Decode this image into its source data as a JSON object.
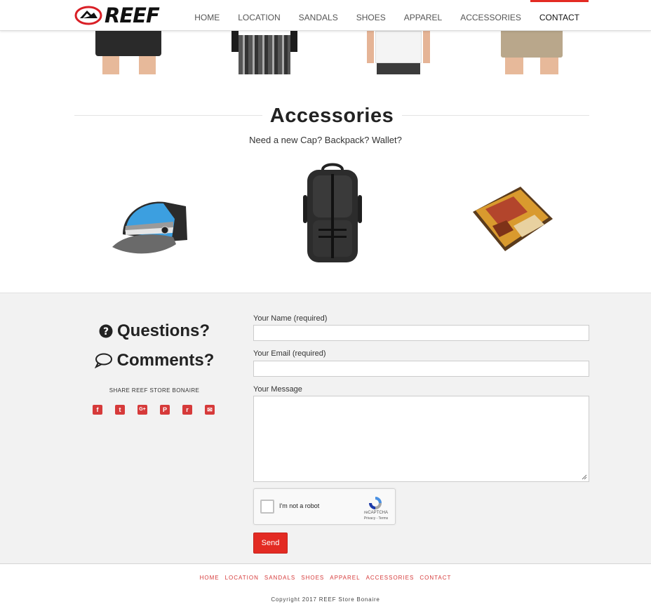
{
  "brand": {
    "logo_text": "REEF"
  },
  "nav": {
    "items": [
      {
        "label": "HOME"
      },
      {
        "label": "LOCATION"
      },
      {
        "label": "SANDALS"
      },
      {
        "label": "SHOES"
      },
      {
        "label": "APPAREL"
      },
      {
        "label": "ACCESSORIES"
      },
      {
        "label": "CONTACT",
        "active": true
      }
    ]
  },
  "accessories": {
    "title": "Accessories",
    "subtitle": "Need a new Cap? Backpack? Wallet?",
    "items": [
      {
        "name": "cap"
      },
      {
        "name": "backpack"
      },
      {
        "name": "wallet"
      }
    ]
  },
  "contact": {
    "questions_heading": "Questions?",
    "comments_heading": "Comments?",
    "share_label": "SHARE REEF STORE BONAIRE",
    "socials": [
      {
        "icon": "facebook-icon",
        "glyph": "f"
      },
      {
        "icon": "twitter-icon",
        "glyph": "t"
      },
      {
        "icon": "google-plus-icon",
        "glyph": "G+"
      },
      {
        "icon": "pinterest-icon",
        "glyph": "P"
      },
      {
        "icon": "reddit-icon",
        "glyph": "r"
      },
      {
        "icon": "email-icon",
        "glyph": "✉"
      }
    ],
    "form": {
      "name_label": "Your Name (required)",
      "name_value": "",
      "email_label": "Your Email (required)",
      "email_value": "",
      "message_label": "Your Message",
      "message_value": "",
      "captcha_label": "I'm not a robot",
      "captcha_brand": "reCAPTCHA",
      "captcha_links": "Privacy - Terms",
      "send_label": "Send"
    }
  },
  "footer": {
    "links": [
      {
        "label": "HOME"
      },
      {
        "label": "LOCATION"
      },
      {
        "label": "SANDALS"
      },
      {
        "label": "SHOES"
      },
      {
        "label": "APPAREL"
      },
      {
        "label": "ACCESSORIES"
      },
      {
        "label": "CONTACT"
      }
    ],
    "copyright": "Copyright 2017 REEF Store Bonaire"
  },
  "colors": {
    "accent": "#e32b23",
    "footer_link": "#d63a3a",
    "contact_bg": "#f2f2f2"
  }
}
